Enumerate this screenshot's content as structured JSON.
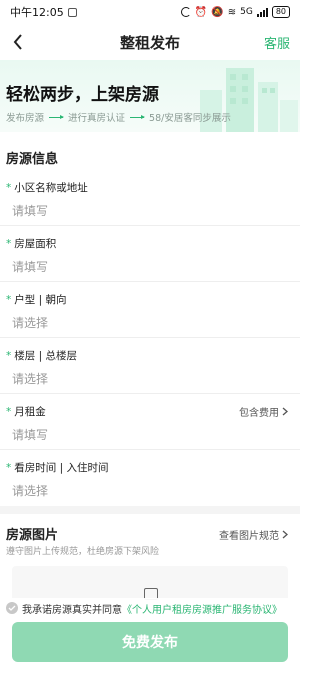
{
  "status_bar": {
    "time": "中午12:05",
    "network": "5G",
    "battery": "80"
  },
  "nav": {
    "title": "整租发布",
    "right_action": "客服"
  },
  "banner": {
    "title": "轻松两步，上架房源",
    "steps": [
      "发布房源",
      "进行真房认证",
      "58/安居客同步展示"
    ]
  },
  "listing_info": {
    "section_title": "房源信息",
    "required_mark": "*",
    "fields": [
      {
        "label": "小区名称或地址",
        "placeholder": "请填写"
      },
      {
        "label": "房屋面积",
        "placeholder": "请填写"
      },
      {
        "label": "户型 | 朝向",
        "placeholder": "请选择"
      },
      {
        "label": "楼层 | 总楼层",
        "placeholder": "请选择"
      },
      {
        "label": "月租金",
        "placeholder": "请填写",
        "extra": "包含费用"
      },
      {
        "label": "看房时间 | 入住时间",
        "placeholder": "请选择"
      }
    ]
  },
  "photos": {
    "title": "房源图片",
    "link": "查看图片规范",
    "subtitle": "遵守图片上传规范，杜绝房源下架风险"
  },
  "agreement": {
    "prefix": "我承诺房源真实并同意",
    "link": "《个人用户租房房源推广服务协议》"
  },
  "publish_button": "免费发布",
  "colors": {
    "accent": "#2bb673",
    "button": "#8fd9b3"
  },
  "icons": [
    "back-arrow-icon",
    "chevron-right-icon",
    "camera-icon",
    "check-icon"
  ]
}
